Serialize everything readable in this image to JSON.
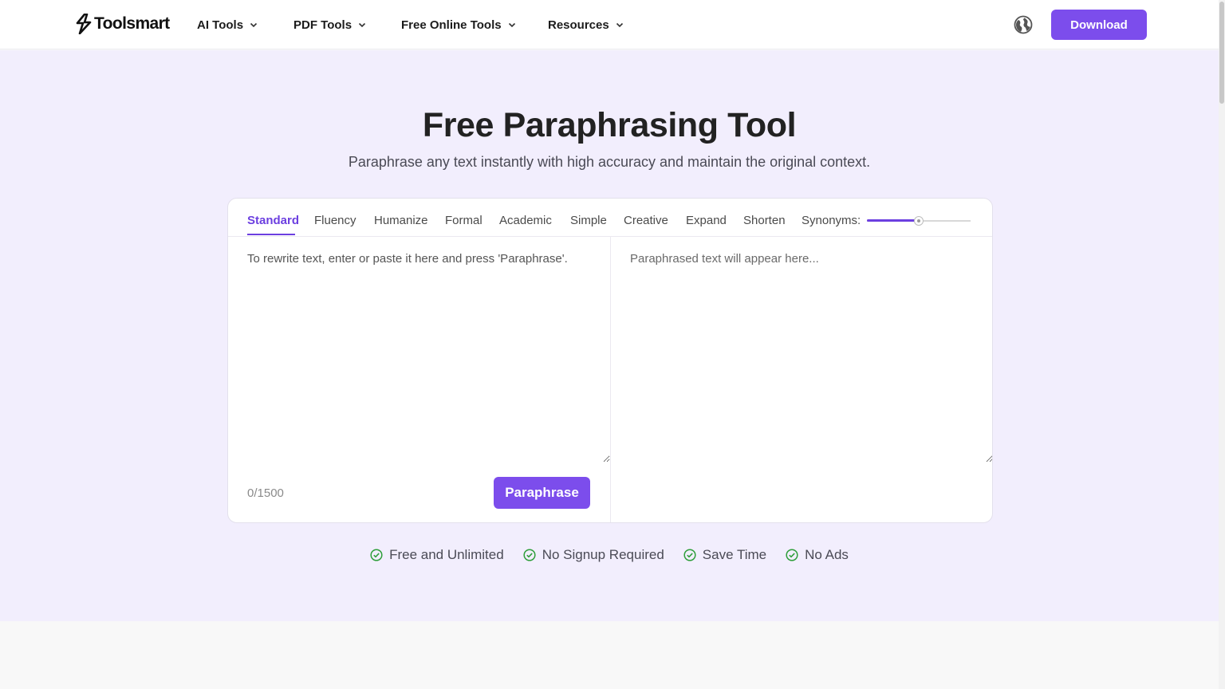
{
  "brand": {
    "name": "Toolsmart"
  },
  "nav": [
    {
      "label": "AI Tools"
    },
    {
      "label": "PDF Tools"
    },
    {
      "label": "Free Online Tools"
    },
    {
      "label": "Resources"
    }
  ],
  "header": {
    "download_label": "Download",
    "language_icon": "globe-icon"
  },
  "hero": {
    "title": "Free Paraphrasing Tool",
    "subtitle": "Paraphrase any text instantly with high accuracy and maintain the original context."
  },
  "tool": {
    "modes": [
      "Standard",
      "Fluency",
      "Humanize",
      "Formal",
      "Academic",
      "Simple",
      "Creative",
      "Expand",
      "Shorten"
    ],
    "active_mode": "Standard",
    "synonyms_label": "Synonyms:",
    "synonyms_level": 0.5,
    "input_placeholder": "To rewrite text, enter or paste it here and press 'Paraphrase'.",
    "output_placeholder": "Paraphrased text will appear here...",
    "char_count": "0/1500",
    "paraphrase_label": "Paraphrase"
  },
  "features": [
    {
      "label": "Free and Unlimited"
    },
    {
      "label": "No Signup Required"
    },
    {
      "label": "Save Time"
    },
    {
      "label": "No Ads"
    }
  ],
  "colors": {
    "accent": "#7c4dec",
    "hero_bg": "#f2eefd",
    "check": "#2e9e3a"
  }
}
